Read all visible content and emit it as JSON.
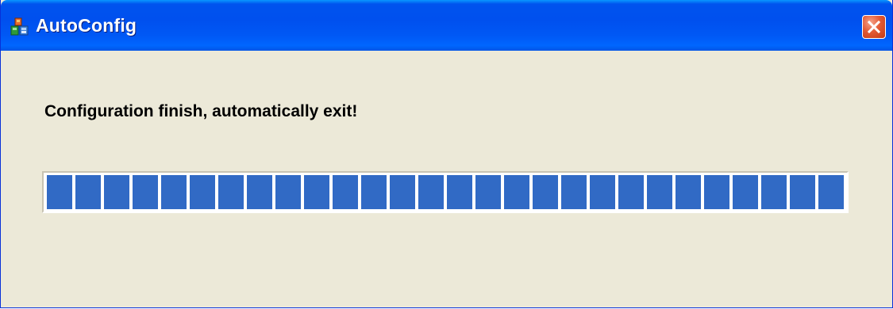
{
  "window": {
    "title": "AutoConfig",
    "icon": "autoconfig-app-icon",
    "close_icon": "close-icon"
  },
  "dialog": {
    "message": "Configuration finish, automatically exit!",
    "progress_percent": 100
  },
  "colors": {
    "titlebar": "#0053ee",
    "background": "#ece9d8",
    "progress_block": "#316ac5",
    "close_button": "#e35a35"
  }
}
